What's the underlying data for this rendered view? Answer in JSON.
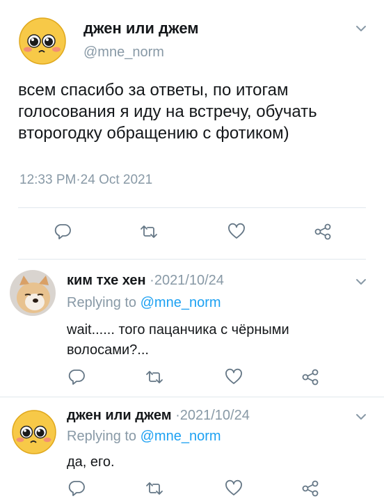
{
  "main_tweet": {
    "display_name": "джен или джем",
    "handle": "@mne_norm",
    "text": "всем спасибо за ответы, по итогам голосования я иду на встречу, обучать второгодку обращению с фотиком)",
    "timestamp": "12:33 PM·24 Oct 2021",
    "avatar_icon": "blushing-emoji-avatar"
  },
  "replies": [
    {
      "display_name": "ким тхе хен",
      "date": "·2021/10/24",
      "replying_prefix": "Replying to ",
      "replying_to": "@mne_norm",
      "text": "wait...... того пацанчика с чёрными волосами?...",
      "avatar_icon": "shiba-dog-avatar"
    },
    {
      "display_name": "джен или джем",
      "date": "·2021/10/24",
      "replying_prefix": "Replying to ",
      "replying_to": "@mne_norm",
      "text": "да, его.",
      "avatar_icon": "blushing-emoji-avatar"
    }
  ],
  "icons": {
    "reply": "reply-icon",
    "retweet": "retweet-icon",
    "like": "like-icon",
    "share": "share-icon",
    "menu": "chevron-down-icon"
  },
  "colors": {
    "text": "#14171a",
    "secondary": "#8899a6",
    "link": "#1da1f2",
    "divider": "#e1e8ed",
    "icon": "#657786"
  }
}
